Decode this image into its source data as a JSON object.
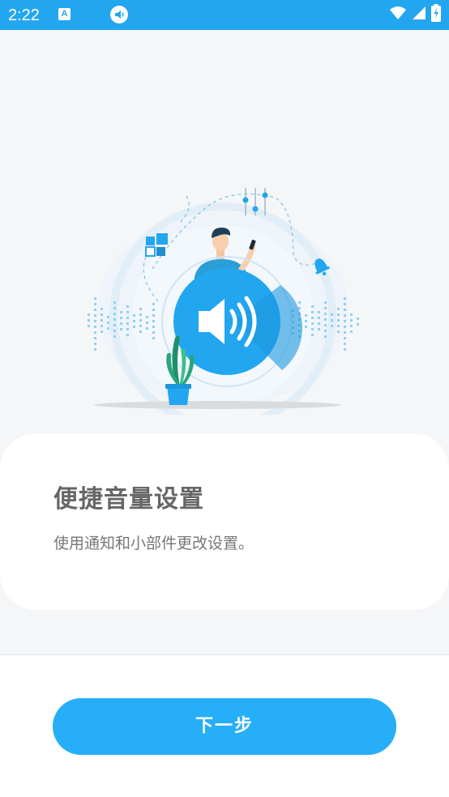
{
  "status_bar": {
    "time": "2:22",
    "notification_a_glyph": "A",
    "icons": [
      "a-notification-icon",
      "volume-notification-icon",
      "wifi-icon",
      "cell-signal-icon",
      "battery-charging-icon"
    ],
    "background_color": "#23a6f0"
  },
  "illustration": {
    "icons": [
      "volume-speaker-icon",
      "app-grid-icon",
      "bell-icon",
      "equalizer-sliders-icon",
      "person-with-phone",
      "potted-plant"
    ],
    "accent_color": "#23a6f0"
  },
  "card": {
    "title": "便捷音量设置",
    "subtitle": "使用通知和小部件更改设置。"
  },
  "footer": {
    "next_button_label": "下一步",
    "button_color": "#27aef8"
  }
}
